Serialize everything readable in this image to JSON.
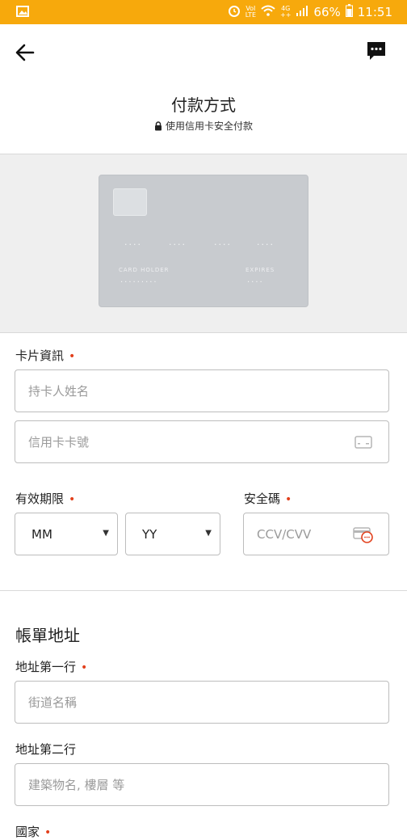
{
  "status_bar": {
    "vol_label_1": "VoI",
    "vol_label_2": "LTE",
    "net_label_1": "4G",
    "net_label_2": "++",
    "battery": "66%",
    "time": "11:51"
  },
  "header": {
    "title": "付款方式",
    "secure_note": "使用信用卡安全付款"
  },
  "card_preview": {
    "number_groups": [
      "····",
      "····",
      "····",
      "····"
    ],
    "holder_label": "CARD HOLDER",
    "holder_value": "·········",
    "expires_label": "EXPIRES",
    "expires_value": "····"
  },
  "card_info": {
    "label": "卡片資訊",
    "required_mark": "•",
    "holder_placeholder": "持卡人姓名",
    "number_placeholder": "信用卡卡號",
    "expiry_label": "有效期限",
    "month_value": "MM",
    "year_value": "YY",
    "cvv_label": "安全碼",
    "cvv_placeholder": "CCV/CVV"
  },
  "billing": {
    "title": "帳單地址",
    "line1_label": "地址第一行",
    "line1_placeholder": "街道名稱",
    "line2_label": "地址第二行",
    "line2_placeholder": "建築物名, 樓層 等",
    "country_label": "國家"
  },
  "colors": {
    "status_bar": "#f7a90c",
    "required": "#e2401c",
    "card": "#c8cbcf"
  }
}
